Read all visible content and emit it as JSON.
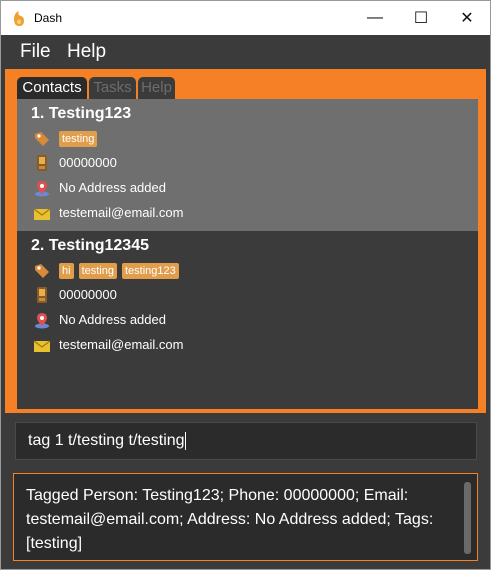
{
  "window": {
    "title": "Dash",
    "minimize_label": "—",
    "maximize_label": "☐",
    "close_label": "✕"
  },
  "menu": {
    "file": "File",
    "help": "Help"
  },
  "tabs": [
    {
      "label": "Contacts",
      "active": true
    },
    {
      "label": "Tasks",
      "active": false
    },
    {
      "label": "Help",
      "active": false
    }
  ],
  "contacts": [
    {
      "index_name": "1.  Testing123",
      "tags": [
        "testing"
      ],
      "phone": "00000000",
      "address": "No Address added",
      "email": "testemail@email.com"
    },
    {
      "index_name": "2.  Testing12345",
      "tags": [
        "hi",
        "testing",
        "testing123"
      ],
      "phone": "00000000",
      "address": "No Address added",
      "email": "testemail@email.com"
    }
  ],
  "command_box": {
    "value": "tag 1 t/testing  t/testing"
  },
  "result": {
    "text": "Tagged Person: Testing123; Phone: 00000000; Email: testemail@email.com; Address: No Address added; Tags: [testing]"
  },
  "colors": {
    "accent": "#f58025",
    "panel": "#3b3b3b",
    "selected_card": "#6f6f6f",
    "tag": "#e09d4c"
  },
  "icons": [
    "dash-app-icon",
    "tag-icon",
    "phone-icon",
    "location-pin-icon",
    "envelope-icon"
  ]
}
